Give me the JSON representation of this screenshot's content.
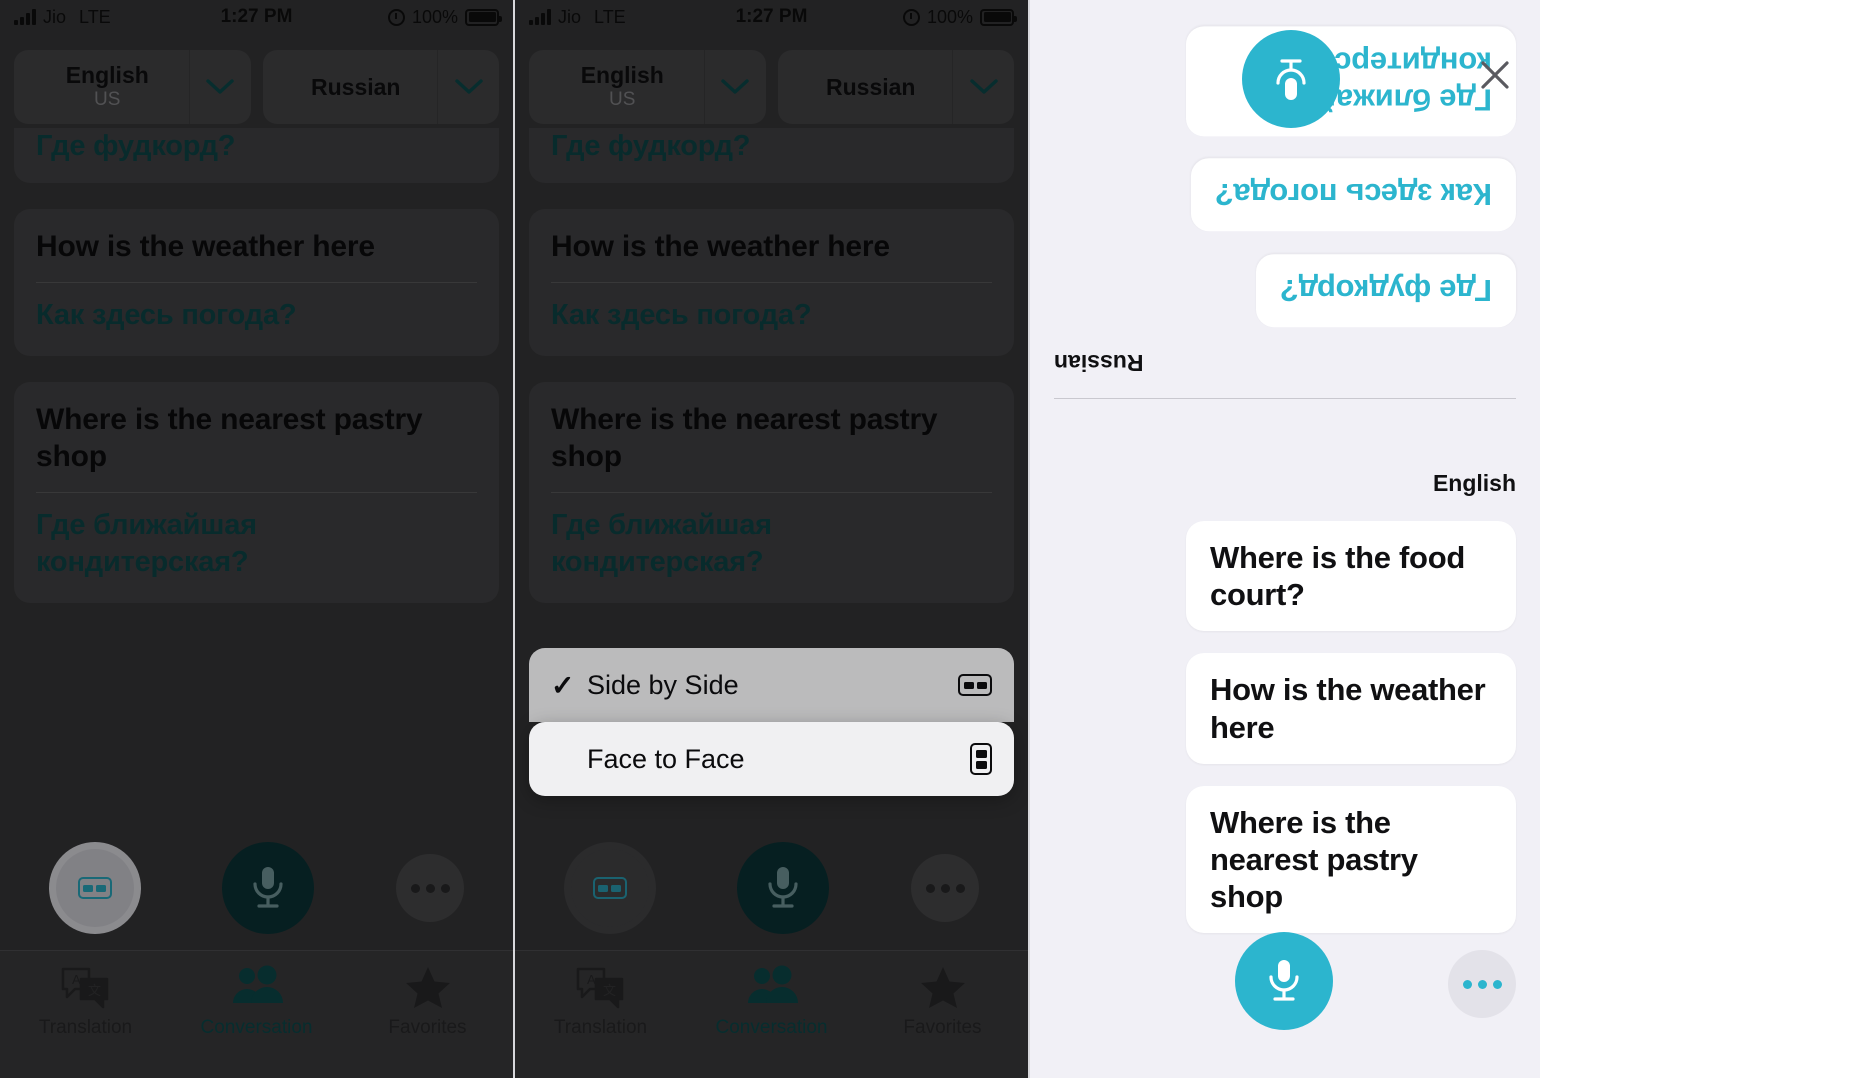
{
  "status_bar": {
    "carrier": "Jio",
    "network": "LTE",
    "time": "1:27 PM",
    "battery_pct": "100%"
  },
  "language_bar": {
    "source": {
      "name": "English",
      "region": "US"
    },
    "target": {
      "name": "Russian",
      "region": ""
    },
    "chevron_icon": "chevron-down-icon"
  },
  "conversation": {
    "cards": [
      {
        "source": "Where is the food court?",
        "target": "Где фудкорд?",
        "partial": true
      },
      {
        "source": "How is the weather here",
        "target": "Как здесь погода?",
        "partial": false
      },
      {
        "source": "Where is the nearest pastry shop",
        "target": "Где ближайшая кондитерская?",
        "partial": false
      }
    ]
  },
  "controls": {
    "layout_toggle_icon": "side-by-side-icon",
    "mic_icon": "microphone-icon",
    "more_icon": "more-ellipsis-icon"
  },
  "tab_bar": {
    "tabs": [
      {
        "label": "Translation",
        "icon": "translate-icon",
        "active": false
      },
      {
        "label": "Conversation",
        "icon": "people-icon",
        "active": true
      },
      {
        "label": "Favorites",
        "icon": "star-icon",
        "active": false
      }
    ]
  },
  "context_menu": {
    "items": [
      {
        "label": "Side by Side",
        "checked": true,
        "icon": "side-by-side-icon",
        "highlighted": false
      },
      {
        "label": "Face to Face",
        "checked": false,
        "icon": "face-to-face-icon",
        "highlighted": true
      }
    ],
    "check_glyph": "✓"
  },
  "face_to_face": {
    "close_icon": "close-icon",
    "mic_icon": "microphone-icon",
    "more_icon": "more-ellipsis-icon",
    "top_language_label": "Russian",
    "bottom_language_label": "English",
    "top_bubbles": [
      "Где ближайшая кондитерская?",
      "Как здесь погода?",
      "Где фудкорд?"
    ],
    "bottom_bubbles": [
      "Where is the food court?",
      "How is the weather here",
      "Where is the nearest pastry shop"
    ]
  },
  "colors": {
    "accent_cyan": "#2cb5ce",
    "dark_teal": "#0c3639",
    "panel_dark": "#3b3b3d",
    "card_dark": "#48484a",
    "panel_light": "#f1f0f6"
  }
}
